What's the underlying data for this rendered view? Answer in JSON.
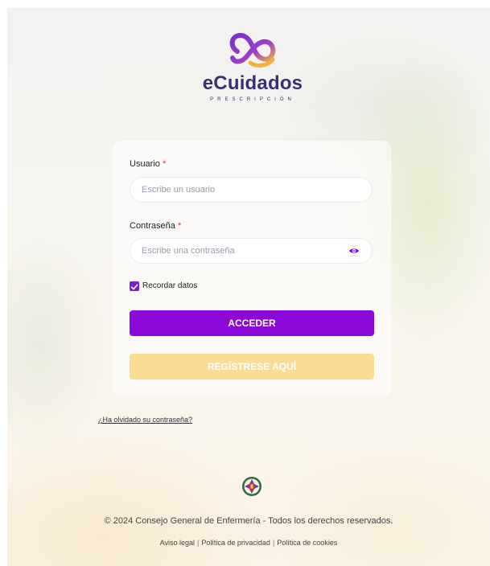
{
  "brand": {
    "name": "eCuidados",
    "subtitle": "PRESCRIPCIÓN",
    "logo_colors": [
      "#7a2fd0",
      "#f2b23a"
    ]
  },
  "form": {
    "username_label": "Usuario",
    "username_required_mark": "*",
    "username_placeholder": "Escribe un usuario",
    "username_value": "",
    "password_label": "Contraseña",
    "password_required_mark": "*",
    "password_placeholder": "Escribe una contraseña",
    "password_value": "",
    "show_password_icon": "eye-icon",
    "remember_label": "Recordar datos",
    "remember_checked": true,
    "submit_label": "ACCEDER",
    "register_label": "REGÍSTRESE AQUÍ",
    "accent_color": "#8b08d6",
    "register_color": "#fbdc94"
  },
  "forgot_password_label": "¿Ha olvidado su contraseña?",
  "footer": {
    "crest_icon": "crest-icon",
    "copyright": "© 2024 Consejo General de Enfermería - Todos los derechos reservados.",
    "links": [
      {
        "label": "Aviso legal"
      },
      {
        "label": "Política de privacidad"
      },
      {
        "label": "Política de cookies"
      }
    ],
    "separator": "|"
  }
}
